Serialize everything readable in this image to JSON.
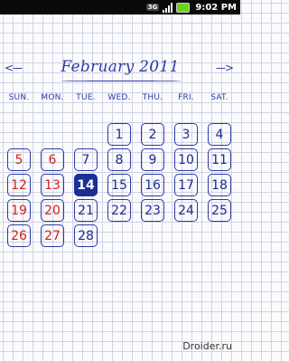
{
  "status_bar": {
    "network": "3G",
    "clock": "9:02 PM",
    "colors": {
      "background": "#0a0a0a",
      "battery": "#6ed11e"
    }
  },
  "calendar": {
    "prev_label": "<---",
    "next_label": "--->",
    "title": "February 2011",
    "weekdays": [
      "SUN.",
      "MON.",
      "TUE.",
      "WED.",
      "THU.",
      "FRI.",
      "SAT."
    ],
    "start_weekday_index": 2,
    "days_in_month": 28,
    "today": 14,
    "weekend_days": [
      5,
      6,
      12,
      13,
      19,
      20,
      26,
      27
    ],
    "colors": {
      "ink_blue": "#2d3aa3",
      "weekend_red": "#d22020",
      "today_fill": "#1b2f96"
    }
  },
  "watermark": "Droider.ru"
}
